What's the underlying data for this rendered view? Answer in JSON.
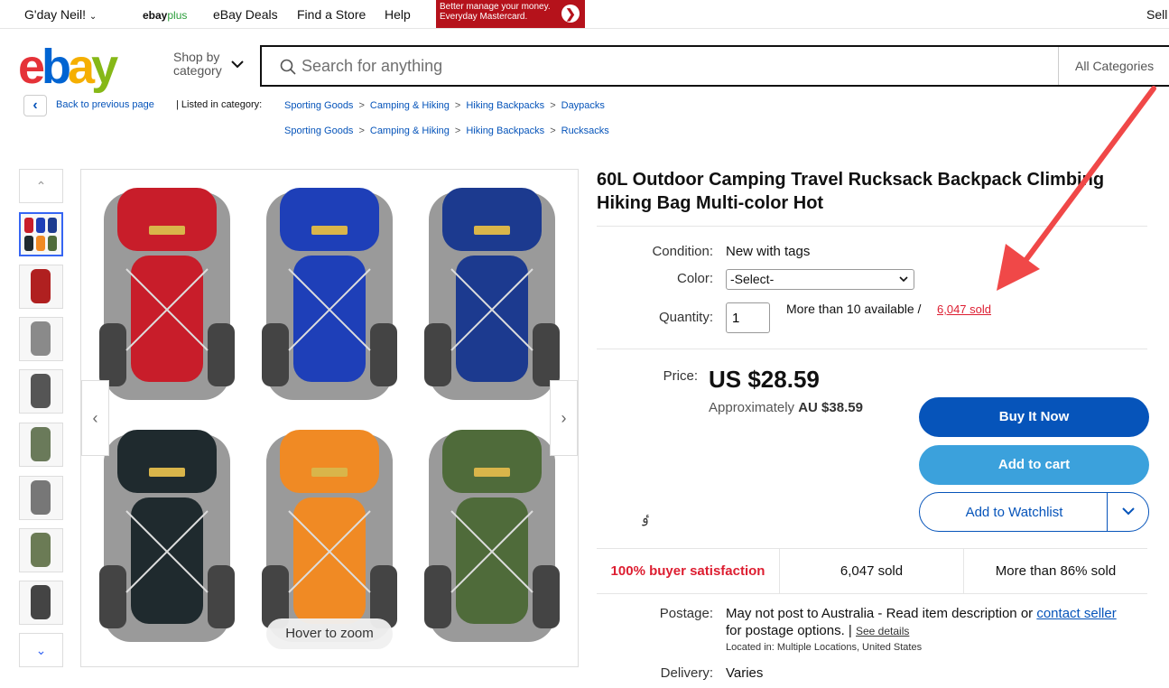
{
  "topbar": {
    "greeting": "G'day Neil!",
    "ebayplus_a": "ebay",
    "ebayplus_b": "plus",
    "deals": "eBay Deals",
    "store": "Find a Store",
    "help": "Help",
    "ad_line1": "Better manage your money.",
    "ad_line2": "Everyday Mastercard.",
    "sell": "Sell"
  },
  "header": {
    "logo_letters": [
      "e",
      "b",
      "a",
      "y"
    ],
    "logo_colors": [
      "#e53238",
      "#0064d2",
      "#f5af02",
      "#86b817"
    ],
    "shop_by_1": "Shop by",
    "shop_by_2": "category",
    "search_placeholder": "Search for anything",
    "all_categories": "All Categories"
  },
  "breadcrumb": {
    "back": "Back to previous page",
    "listed_in": "| Listed in category:",
    "path1": [
      "Sporting Goods",
      "Camping & Hiking",
      "Hiking Backpacks",
      "Daypacks"
    ],
    "path2": [
      "Sporting Goods",
      "Camping & Hiking",
      "Hiking Backpacks",
      "Rucksacks"
    ]
  },
  "gallery": {
    "hover_to_zoom": "Hover to zoom",
    "pack_colors": [
      "#c81d2a",
      "#1e3fb8",
      "#1c3a8f",
      "#1f2a2e",
      "#f08a24",
      "#4f6b3a"
    ],
    "thumb_colors": [
      "#7a7a7a",
      "#b02020",
      "#8a8a8a",
      "#555",
      "#6a7a5a",
      "#777",
      "#6b7b55",
      "#444"
    ]
  },
  "item": {
    "title": "60L Outdoor Camping Travel Rucksack Backpack Climbing Hiking Bag Multi-color Hot",
    "condition_label": "Condition:",
    "condition_value": "New with tags",
    "color_label": "Color:",
    "color_select": "-Select-",
    "quantity_label": "Quantity:",
    "quantity_value": "1",
    "availability": "More than 10 available /",
    "sold_link": "6,047 sold",
    "price_label": "Price:",
    "price": "US $28.59",
    "approx_label": "Approximately",
    "approx_value": "AU $38.59",
    "buy_now": "Buy It Now",
    "add_cart": "Add to cart",
    "watchlist": "Add to Watchlist"
  },
  "stats": {
    "satisfaction": "100% buyer satisfaction",
    "sold": "6,047 sold",
    "percent_sold": "More than 86% sold"
  },
  "postage": {
    "label": "Postage:",
    "text": "May not post to Australia - Read item description or",
    "contact": "contact seller",
    "text2": "for postage options. |",
    "see_details": "See details",
    "located_label": "Located in:",
    "located_value": "Multiple Locations, United States",
    "delivery_label": "Delivery:",
    "delivery_value": "Varies"
  },
  "colors": {
    "link": "#0654ba",
    "buy": "#0654ba",
    "cart": "#3ba1dc",
    "red": "#dd1e31",
    "annotation_arrow": "#f04848"
  }
}
